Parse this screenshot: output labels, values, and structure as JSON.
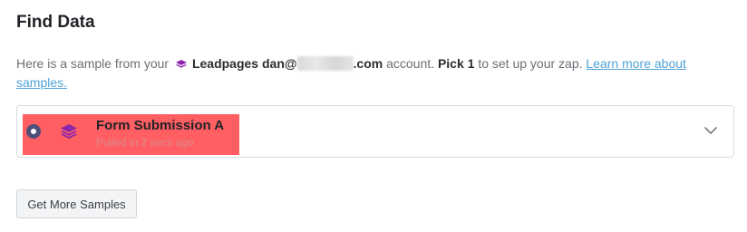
{
  "page": {
    "title": "Find Data"
  },
  "intro": {
    "prefix": "Here is a sample from your",
    "app_name": "Leadpages",
    "account_prefix": "dan@",
    "account_suffix": ".com",
    "account_word": "account.",
    "pick_label": "Pick 1",
    "pick_rest": "to set up your zap.",
    "link_text": "Learn more about samples."
  },
  "sample": {
    "title": "Form Submission A",
    "subtitle": "Pulled in 2 secs ago",
    "selected": true,
    "icon": "leadpages-icon"
  },
  "actions": {
    "more_samples_label": "Get More Samples"
  },
  "colors": {
    "leadpages_purple": "#8e24aa",
    "highlight": "#ff5f63",
    "link": "#4fa3d8",
    "radio": "#4e4f7a"
  }
}
